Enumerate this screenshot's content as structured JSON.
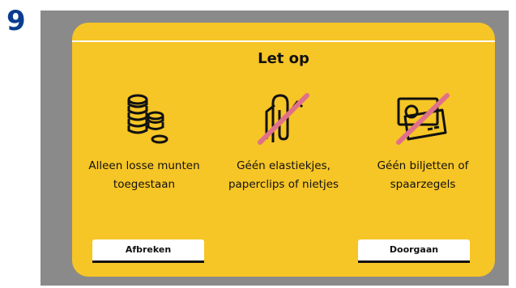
{
  "step_number": "9",
  "dialog": {
    "title": "Let op",
    "notices": [
      {
        "icon": "coins-icon",
        "text": "Alleen losse munten\ntoegestaan"
      },
      {
        "icon": "no-paperclip-icon",
        "text": "Géén elastiekjes,\npaperclips of nietjes"
      },
      {
        "icon": "no-banknotes-icon",
        "text": "Géén biljetten of\nspaarzegels"
      }
    ],
    "cancel_label": "Afbreken",
    "continue_label": "Doorgaan"
  },
  "colors": {
    "panel": "#f6c526",
    "background": "#8a8a8a",
    "step_number": "#0a3d8f",
    "strike": "#e0708a"
  }
}
